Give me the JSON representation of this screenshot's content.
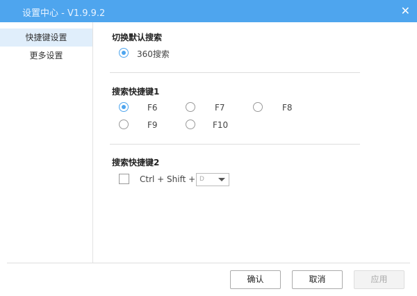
{
  "window": {
    "title": "设置中心 - V1.9.9.2",
    "close_icon": "close-icon"
  },
  "sidebar": {
    "items": [
      {
        "label": "快捷键设置",
        "active": true
      },
      {
        "label": "更多设置",
        "active": false
      }
    ]
  },
  "sections": {
    "default_search": {
      "title": "切换默认搜索",
      "options": [
        {
          "label": "360搜索",
          "selected": true
        }
      ]
    },
    "hotkey1": {
      "title": "搜索快捷键1",
      "options": [
        {
          "label": "F6",
          "selected": true
        },
        {
          "label": "F7",
          "selected": false
        },
        {
          "label": "F8",
          "selected": false
        },
        {
          "label": "F9",
          "selected": false
        },
        {
          "label": "F10",
          "selected": false
        }
      ]
    },
    "hotkey2": {
      "title": "搜索快捷键2",
      "checked": false,
      "combo_label": "Ctrl + Shift +",
      "key_value": "D"
    }
  },
  "footer": {
    "ok": "确认",
    "cancel": "取消",
    "apply": "应用",
    "apply_disabled": true
  },
  "colors": {
    "accent": "#4ea5ee"
  }
}
